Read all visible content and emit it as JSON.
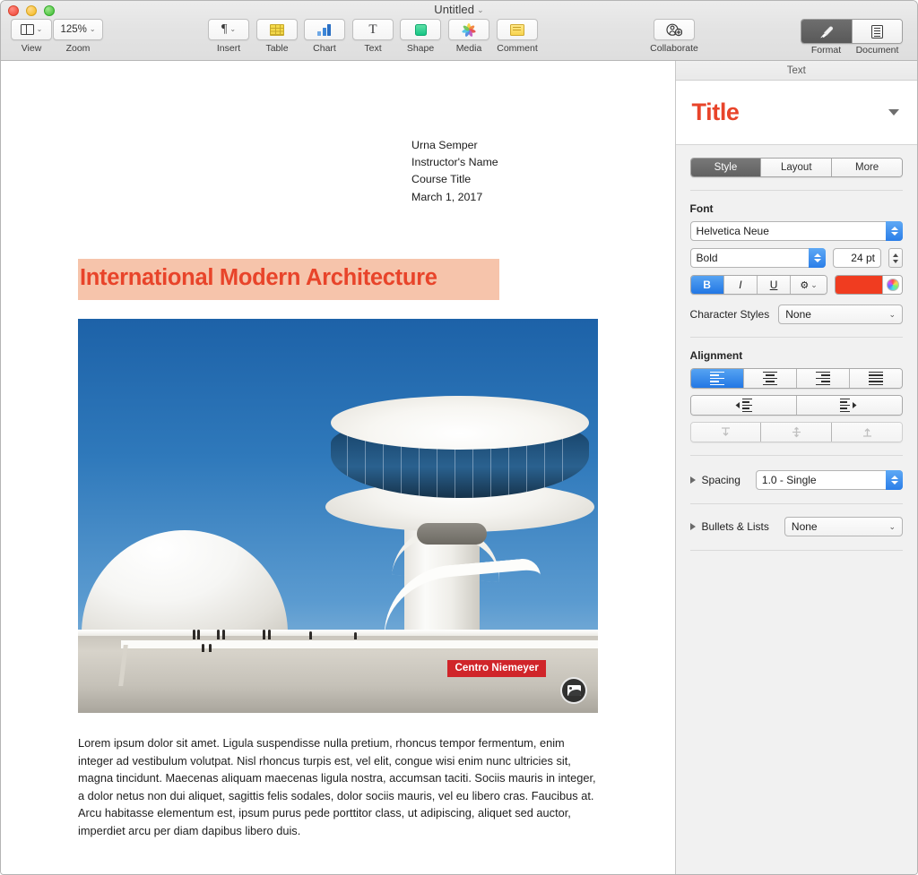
{
  "window": {
    "title": "Untitled",
    "title_chevron": "⌄",
    "traffic_lights": [
      "close",
      "minimize",
      "zoom"
    ]
  },
  "toolbar": {
    "items": [
      {
        "name": "view",
        "label": "View",
        "icon": "window-icon",
        "chevron": "⌄"
      },
      {
        "name": "zoom",
        "label": "Zoom",
        "value": "125%",
        "chevron": "⌄"
      },
      {
        "name": "insert",
        "label": "Insert",
        "icon": "pilcrow-icon",
        "chevron": "⌄"
      },
      {
        "name": "table",
        "label": "Table",
        "icon": "table-icon"
      },
      {
        "name": "chart",
        "label": "Chart",
        "icon": "bar-chart-icon"
      },
      {
        "name": "text",
        "label": "Text",
        "icon": "text-t-icon"
      },
      {
        "name": "shape",
        "label": "Shape",
        "icon": "shape-square-icon"
      },
      {
        "name": "media",
        "label": "Media",
        "icon": "photos-pinwheel-icon"
      },
      {
        "name": "comment",
        "label": "Comment",
        "icon": "comment-note-icon"
      },
      {
        "name": "collaborate",
        "label": "Collaborate",
        "icon": "collaborate-person-icon"
      }
    ],
    "right": {
      "format_label": "Format",
      "document_label": "Document",
      "format_icon": "paintbrush-icon",
      "document_icon": "document-lines-icon",
      "active": "Format"
    }
  },
  "document": {
    "header_lines": [
      "Urna Semper",
      "Instructor's Name",
      "Course Title",
      "March 1, 2017"
    ],
    "title": "International Modern Architecture",
    "title_color": "#e8442a",
    "title_highlight": "#f6c4ab",
    "image": {
      "alt": "Centro Niemeyer cultural centre under blue sky",
      "sign_text": "Centro Niemeyer",
      "sign_color": "#d0252a",
      "badge_icon": "image-placeholder-icon"
    },
    "paragraph": "Lorem ipsum dolor sit amet. Ligula suspendisse nulla pretium, rhoncus tempor fermentum, enim integer ad vestibulum volutpat. Nisl rhoncus turpis est, vel elit, congue wisi enim nunc ultricies sit, magna tincidunt. Maecenas aliquam maecenas ligula nostra, accumsan taciti. Sociis mauris in integer, a dolor netus non dui aliquet, sagittis felis sodales, dolor sociis mauris, vel eu libero cras. Faucibus at. Arcu habitasse elementum est, ipsum purus pede porttitor class, ut adipiscing, aliquet sed auctor, imperdiet arcu per diam dapibus libero duis."
  },
  "inspector": {
    "header": "Text",
    "paragraph_style": "Title",
    "paragraph_style_color": "#e8442a",
    "tabs": [
      {
        "label": "Style",
        "active": true
      },
      {
        "label": "Layout",
        "active": false
      },
      {
        "label": "More",
        "active": false
      }
    ],
    "font": {
      "section_label": "Font",
      "family": "Helvetica Neue",
      "weight": "Bold",
      "size": "24 pt",
      "bold_label": "B",
      "italic_label": "I",
      "underline_label": "U",
      "gear_label": "⚙",
      "gear_chevron": "⌄",
      "bold_active": true,
      "italic_active": false,
      "underline_active": false,
      "color": "#f03c20",
      "color_wheel_icon": "color-wheel-icon",
      "character_styles_label": "Character Styles",
      "character_styles_value": "None"
    },
    "alignment": {
      "section_label": "Alignment",
      "horizontal": [
        {
          "name": "align-left",
          "active": true
        },
        {
          "name": "align-center",
          "active": false
        },
        {
          "name": "align-right",
          "active": false
        },
        {
          "name": "align-justify",
          "active": false
        }
      ],
      "indent": [
        {
          "name": "decrease-indent"
        },
        {
          "name": "increase-indent"
        }
      ],
      "vertical": [
        {
          "name": "align-top",
          "disabled": true
        },
        {
          "name": "align-middle",
          "disabled": true
        },
        {
          "name": "align-bottom",
          "disabled": true
        }
      ]
    },
    "spacing": {
      "label": "Spacing",
      "value": "1.0 - Single"
    },
    "bullets": {
      "label": "Bullets & Lists",
      "value": "None"
    }
  }
}
